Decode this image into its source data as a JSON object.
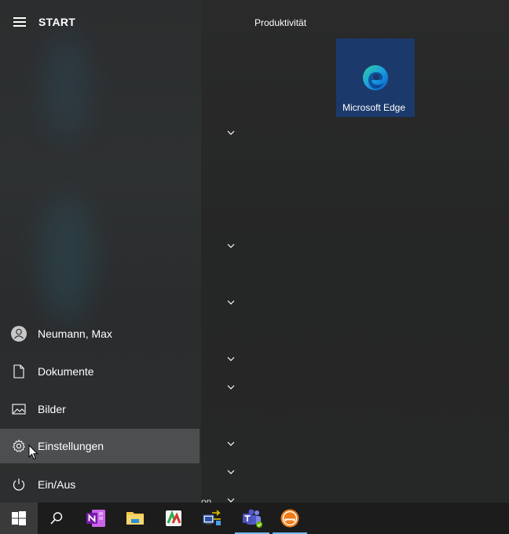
{
  "start_menu": {
    "title": "START",
    "left_items": [
      {
        "label": "Neumann, Max",
        "icon": "user-icon"
      },
      {
        "label": "Dokumente",
        "icon": "document-icon"
      },
      {
        "label": "Bilder",
        "icon": "pictures-icon"
      },
      {
        "label": "Einstellungen",
        "icon": "settings-gear-icon"
      },
      {
        "label": "Ein/Aus",
        "icon": "power-icon"
      }
    ],
    "group_title": "Produktivität",
    "tile": {
      "label": "Microsoft Edge",
      "icon": "edge-icon",
      "color": "#1b3a6b"
    },
    "partial_text": "on"
  },
  "taskbar": {
    "items": [
      "windows-start-icon",
      "search-icon",
      "onenote-icon",
      "file-explorer-icon",
      "charts-app-icon",
      "network-app-icon",
      "teams-icon",
      "sip-app-icon"
    ],
    "accent": "#76b9ed"
  }
}
